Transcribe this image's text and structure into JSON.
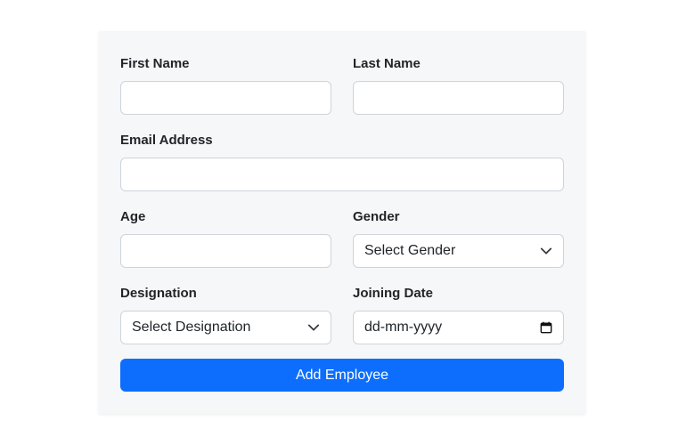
{
  "form": {
    "first_name": {
      "label": "First Name",
      "value": "",
      "placeholder": ""
    },
    "last_name": {
      "label": "Last Name",
      "value": "",
      "placeholder": ""
    },
    "email": {
      "label": "Email Address",
      "value": "",
      "placeholder": ""
    },
    "age": {
      "label": "Age",
      "value": "",
      "placeholder": ""
    },
    "gender": {
      "label": "Gender",
      "selected": "Select Gender"
    },
    "designation": {
      "label": "Designation",
      "selected": "Select Designation"
    },
    "joining_date": {
      "label": "Joining Date",
      "placeholder": "dd-mm-yyyy"
    },
    "submit_label": "Add Employee"
  },
  "icons": {
    "select_chevron": "chevron-down-icon",
    "date_picker": "calendar-icon"
  },
  "colors": {
    "primary": "#0d6efd",
    "card_background": "#f6f7f9",
    "border": "#ced4da",
    "text": "#212529"
  }
}
